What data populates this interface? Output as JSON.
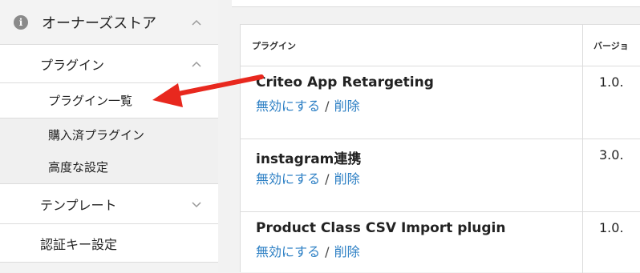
{
  "sidebar": {
    "owners_store": {
      "label": "オーナーズストア",
      "info_icon": "i"
    },
    "plugin": {
      "label": "プラグイン"
    },
    "plugin_list": {
      "label": "プラグイン一覧"
    },
    "purchased": {
      "label": "購入済プラグイン"
    },
    "advanced": {
      "label": "高度な設定"
    },
    "template": {
      "label": "テンプレート"
    },
    "auth_key": {
      "label": "認証キー設定"
    }
  },
  "table": {
    "headers": {
      "plugin": "プラグイン",
      "version": "バージョ"
    },
    "rows": [
      {
        "name": "Criteo App Retargeting",
        "disable": "無効にする",
        "sep": "/",
        "delete": "削除",
        "version": "1.0."
      },
      {
        "name": "instagram連携",
        "disable": "無効にする",
        "sep": "/",
        "delete": "削除",
        "version": "3.0."
      },
      {
        "name": "Product Class CSV Import plugin",
        "disable": "無効にする",
        "sep": "/",
        "delete": "削除",
        "version": "1.0."
      }
    ]
  },
  "colors": {
    "link": "#2c7fc4",
    "arrow": "#e8281e"
  }
}
